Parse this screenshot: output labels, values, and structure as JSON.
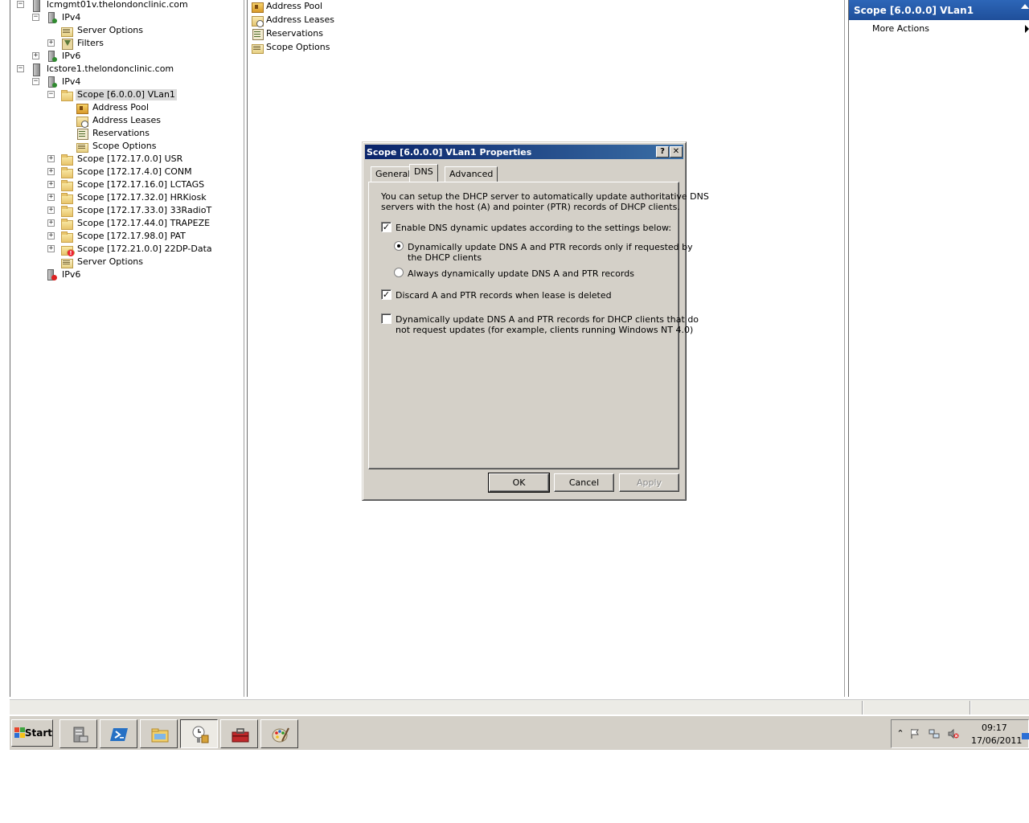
{
  "tree": {
    "nodes": [
      {
        "label": "lcmgmt01v.thelondonclinic.com",
        "icon": "server-icon",
        "expander": "−"
      },
      {
        "label": "IPv4",
        "icon": "ipv4-icon",
        "expander": "−"
      },
      {
        "label": "Server Options",
        "icon": "server-options-icon",
        "expander": ""
      },
      {
        "label": "Filters",
        "icon": "filter-icon",
        "expander": "+"
      },
      {
        "label": "IPv6",
        "icon": "ipv6-icon",
        "expander": "+"
      },
      {
        "label": "lcstore1.thelondonclinic.com",
        "icon": "server-icon",
        "expander": "−"
      },
      {
        "label": "IPv4",
        "icon": "ipv4-icon",
        "expander": "−"
      },
      {
        "label": "Scope [6.0.0.0] VLan1",
        "icon": "folder-icon",
        "expander": "−"
      },
      {
        "label": "Address Pool",
        "icon": "address-pool-icon",
        "expander": ""
      },
      {
        "label": "Address Leases",
        "icon": "address-leases-icon",
        "expander": ""
      },
      {
        "label": "Reservations",
        "icon": "reservations-icon",
        "expander": ""
      },
      {
        "label": "Scope Options",
        "icon": "scope-options-icon",
        "expander": ""
      },
      {
        "label": "Scope [172.17.0.0] USR",
        "icon": "folder-icon",
        "expander": "+"
      },
      {
        "label": "Scope [172.17.4.0] CONM",
        "icon": "folder-icon",
        "expander": "+"
      },
      {
        "label": "Scope [172.17.16.0] LCTAGS",
        "icon": "folder-icon",
        "expander": "+"
      },
      {
        "label": "Scope [172.17.32.0] HRKiosk",
        "icon": "folder-icon",
        "expander": "+"
      },
      {
        "label": "Scope [172.17.33.0] 33RadioT",
        "icon": "folder-icon",
        "expander": "+"
      },
      {
        "label": "Scope [172.17.44.0] TRAPEZE",
        "icon": "folder-icon",
        "expander": "+"
      },
      {
        "label": "Scope [172.17.98.0] PAT",
        "icon": "folder-icon",
        "expander": "+"
      },
      {
        "label": "Scope [172.21.0.0] 22DP-Data",
        "icon": "folder-warning-icon",
        "expander": "+"
      },
      {
        "label": "Server Options",
        "icon": "server-options-icon",
        "expander": ""
      },
      {
        "label": "IPv6",
        "icon": "ipv6-error-icon",
        "expander": ""
      }
    ]
  },
  "list": {
    "items": [
      {
        "label": "Address Pool",
        "icon": "address-pool-icon"
      },
      {
        "label": "Address Leases",
        "icon": "address-leases-icon"
      },
      {
        "label": "Reservations",
        "icon": "reservations-icon"
      },
      {
        "label": "Scope Options",
        "icon": "scope-options-icon"
      }
    ]
  },
  "actions": {
    "header": "Scope [6.0.0.0] VLan1",
    "more_actions": "More Actions"
  },
  "dialog": {
    "title": "Scope [6.0.0.0] VLan1 Properties",
    "help_button": "?",
    "close_button": "✕",
    "tabs": [
      {
        "label": "General",
        "active": false
      },
      {
        "label": "DNS",
        "active": true
      },
      {
        "label": "Advanced",
        "active": false
      }
    ],
    "intro_line1": "You can setup the DHCP server to automatically update authoritative DNS",
    "intro_line2": "servers with the host (A) and pointer (PTR) records of DHCP clients.",
    "enable_dns_label": "Enable DNS dynamic updates according to the settings below:",
    "enable_dns_checked": true,
    "radio_requested_line1": "Dynamically update DNS A and PTR records only if requested by",
    "radio_requested_line2": "the DHCP clients",
    "radio_requested_selected": true,
    "radio_always_label": "Always dynamically update DNS A and PTR records",
    "radio_always_selected": false,
    "discard_label": "Discard A and PTR records when lease is deleted",
    "discard_checked": true,
    "noupdate_line1": "Dynamically update DNS A and PTR records for DHCP clients that do",
    "noupdate_line2": "not request updates (for example, clients running Windows NT 4.0)",
    "noupdate_checked": false,
    "ok_label": "OK",
    "cancel_label": "Cancel",
    "apply_label": "Apply"
  },
  "taskbar": {
    "start_label": "Start",
    "apps": [
      {
        "name": "server-manager-icon",
        "active": false
      },
      {
        "name": "powershell-icon",
        "active": false
      },
      {
        "name": "explorer-icon",
        "active": false
      },
      {
        "name": "dhcp-icon",
        "active": true
      },
      {
        "name": "toolbox-icon",
        "active": false
      },
      {
        "name": "paint-icon",
        "active": false
      }
    ],
    "clock_time": "09:17",
    "clock_date": "17/06/2011"
  },
  "colors": {
    "actions_header": "#1f4f9a",
    "dialog_title": "#0a246a",
    "chrome": "#d4d0c8"
  }
}
